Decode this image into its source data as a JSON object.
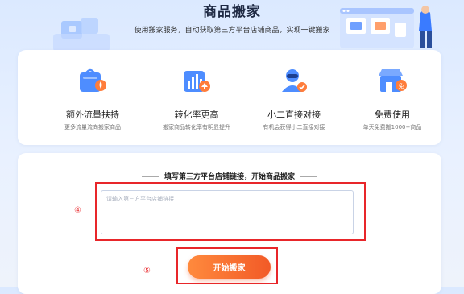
{
  "banner": {
    "title": "商品搬家",
    "subtitle": "使用搬家服务，自动获取第三方平台店铺商品，实现一键搬家"
  },
  "features": [
    {
      "icon": "shopping-bag-traffic-icon",
      "name": "额外流量扶持",
      "desc": "更多流量流向搬家商品"
    },
    {
      "icon": "bar-chart-up-icon",
      "name": "转化率更高",
      "desc": "搬家商品转化率有明显提升"
    },
    {
      "icon": "customer-service-icon",
      "name": "小二直接对接",
      "desc": "有机会获得小二直接对接"
    },
    {
      "icon": "free-store-icon",
      "name": "免费使用",
      "desc": "单天免费搬1000+商品"
    }
  ],
  "form": {
    "heading": "填写第三方平台店铺链接，开始商品搬家",
    "input_placeholder": "请输入第三方平台店铺链接",
    "input_value": "",
    "start_label": "开始搬家"
  },
  "annotations": {
    "marker_input": "④",
    "marker_button": "⑤"
  },
  "colors": {
    "accent": "#f25a27",
    "highlight": "#e8262a",
    "primary_blue": "#3a7bff"
  }
}
